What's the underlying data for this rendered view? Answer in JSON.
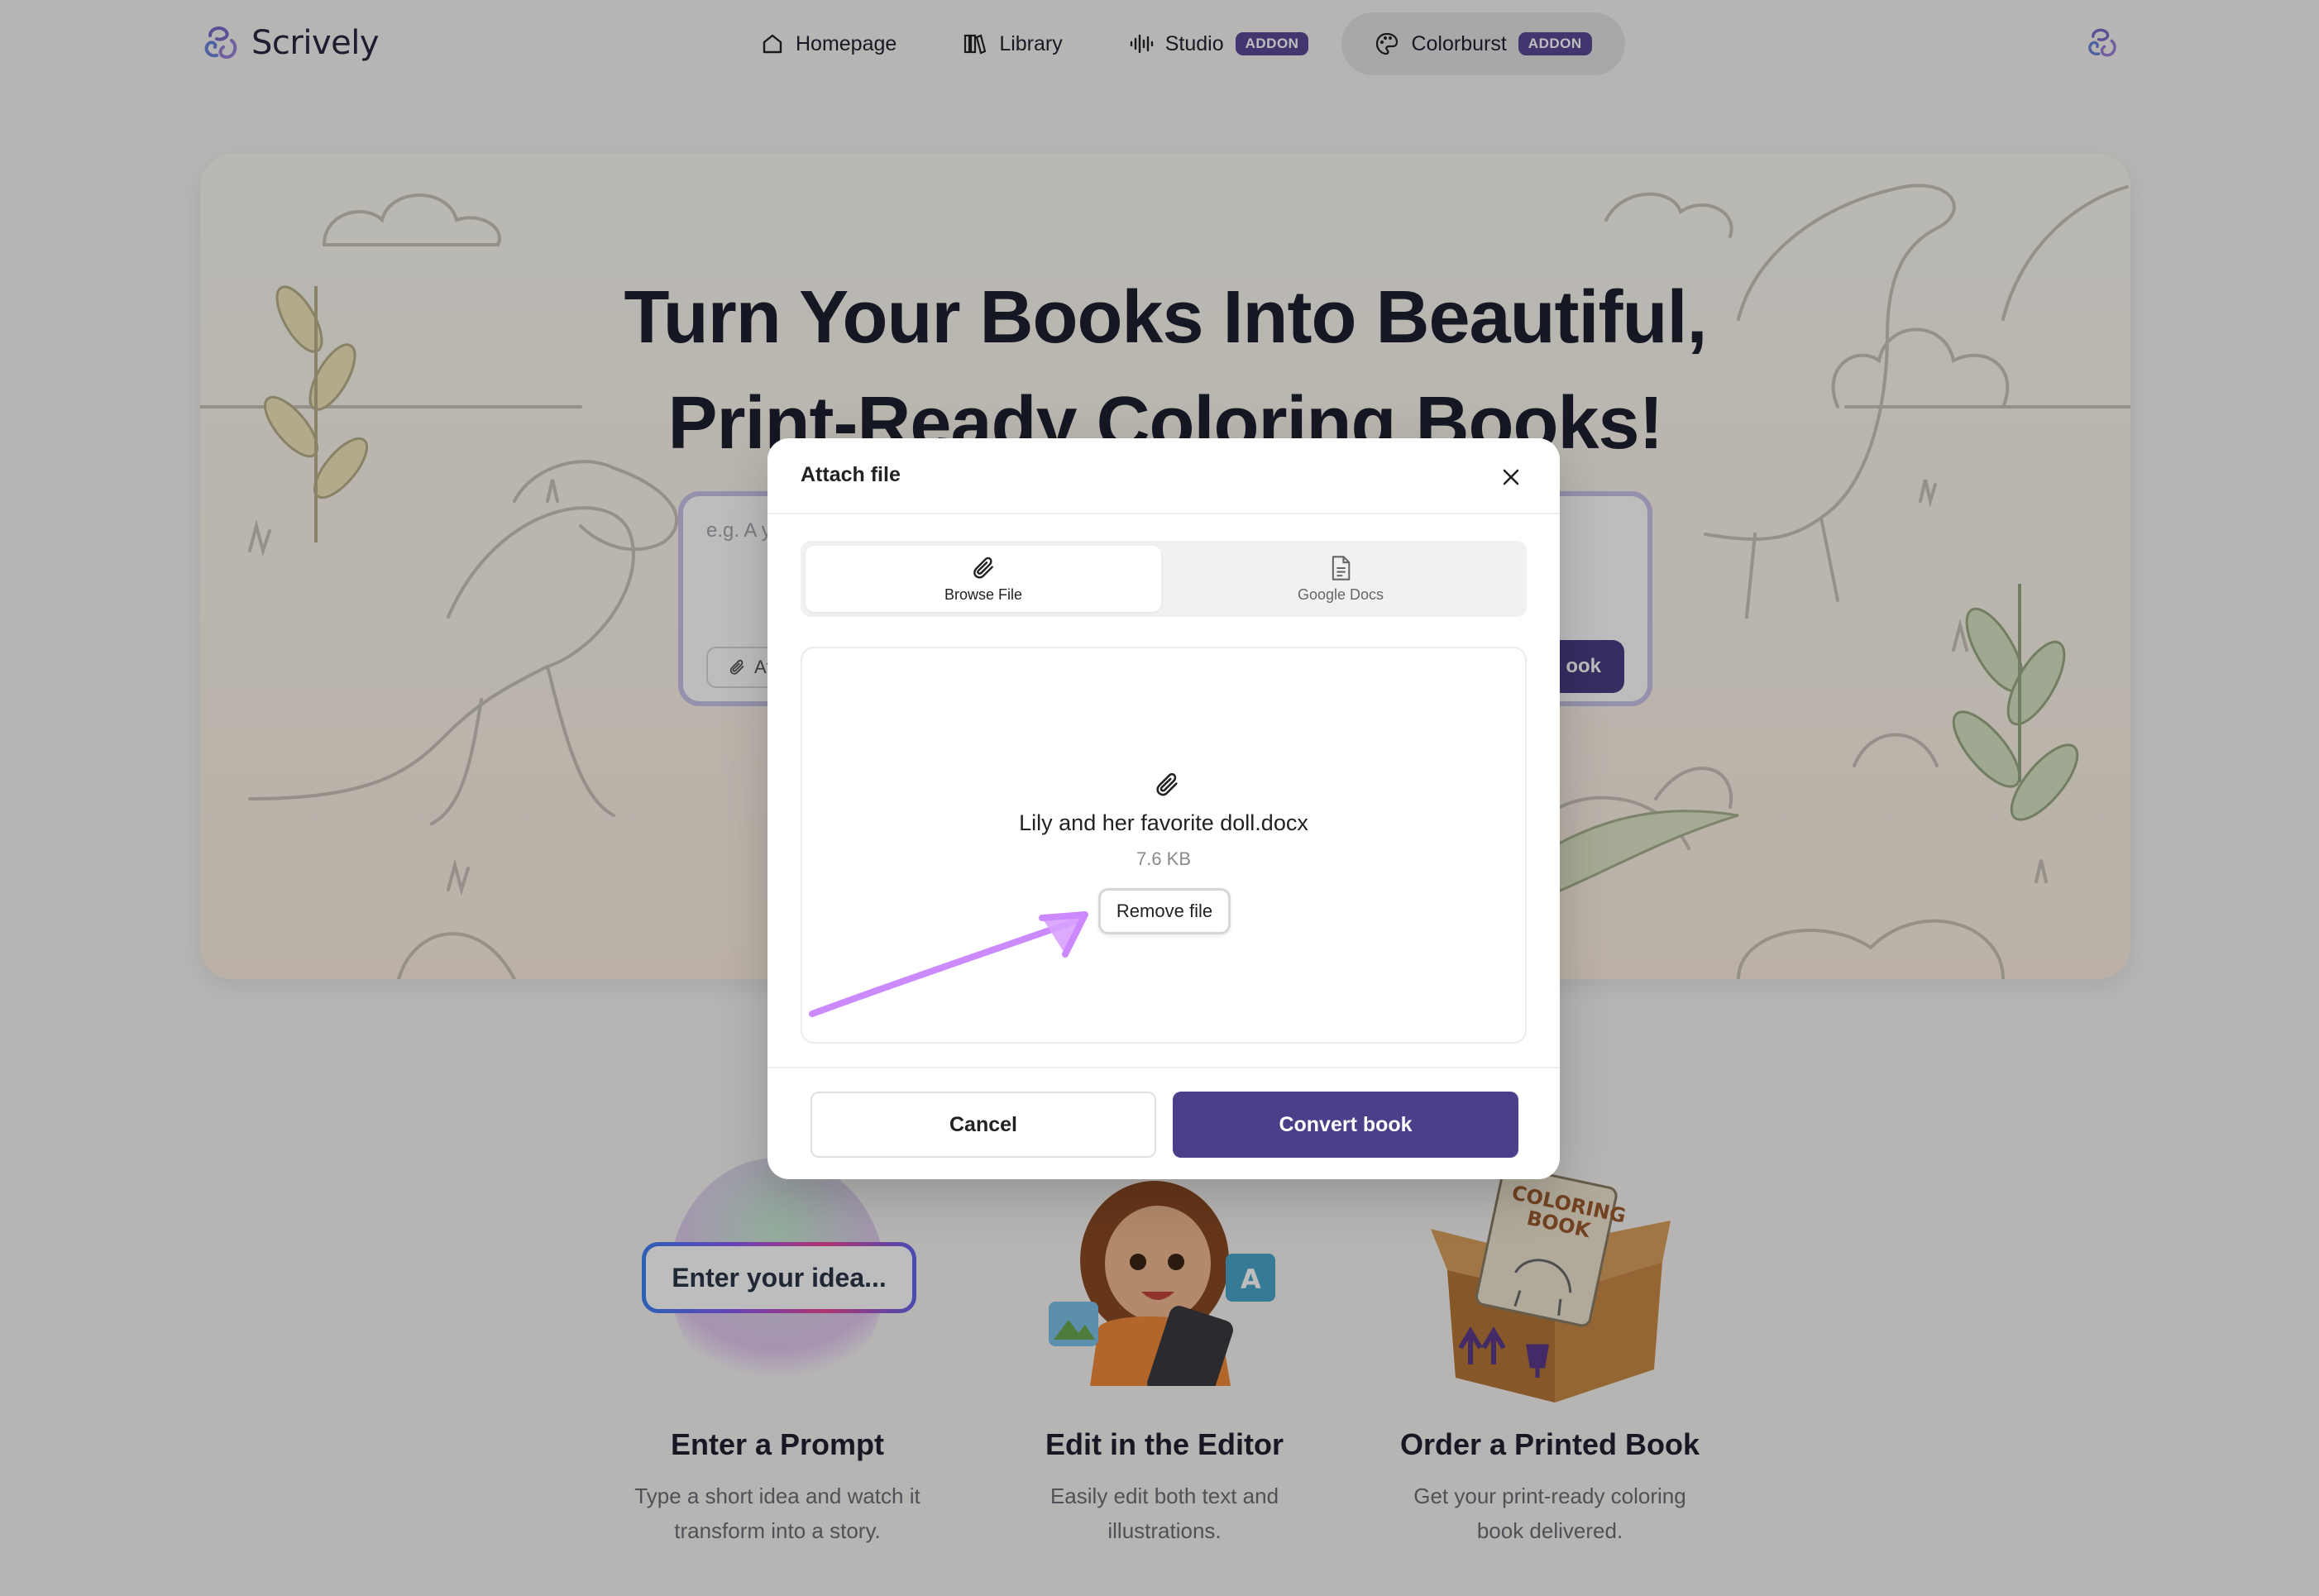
{
  "brand": {
    "name": "Scrively",
    "logo_icon": "swirl-logo-icon",
    "accent": "#5b4a96"
  },
  "nav": {
    "items": [
      {
        "label": "Homepage",
        "icon": "home-icon"
      },
      {
        "label": "Library",
        "icon": "library-icon"
      },
      {
        "label": "Studio",
        "icon": "waveform-icon",
        "badge": "ADDON"
      },
      {
        "label": "Colorburst",
        "icon": "palette-icon",
        "badge": "ADDON",
        "active": true
      }
    ]
  },
  "hero": {
    "title_line1": "Turn Your Books Into Beautiful,",
    "title_line2": "Print-Ready Coloring Books!",
    "prompt_placeholder": "e.g. A y",
    "attach_label": "At",
    "convert_label": "ook"
  },
  "features": [
    {
      "title": "Enter a Prompt",
      "desc_line1": "Type a short idea and watch it",
      "desc_line2": "transform into a story.",
      "pill": "Enter your idea..."
    },
    {
      "title": "Edit in the Editor",
      "desc_line1": "Easily edit both text and",
      "desc_line2": "illustrations."
    },
    {
      "title": "Order a Printed Book",
      "desc_line1": "Get your print-ready coloring",
      "desc_line2": "book delivered.",
      "box_label_1": "COLORING",
      "box_label_2": "BOOK"
    }
  ],
  "modal": {
    "title": "Attach file",
    "tabs": [
      {
        "label": "Browse File",
        "icon": "paperclip-icon",
        "active": true
      },
      {
        "label": "Google Docs",
        "icon": "document-icon",
        "active": false
      }
    ],
    "file": {
      "name": "Lily and her favorite doll.docx",
      "size": "7.6 KB"
    },
    "remove_label": "Remove file",
    "cancel_label": "Cancel",
    "convert_label": "Convert book",
    "annotation_color": "#c77dff"
  }
}
